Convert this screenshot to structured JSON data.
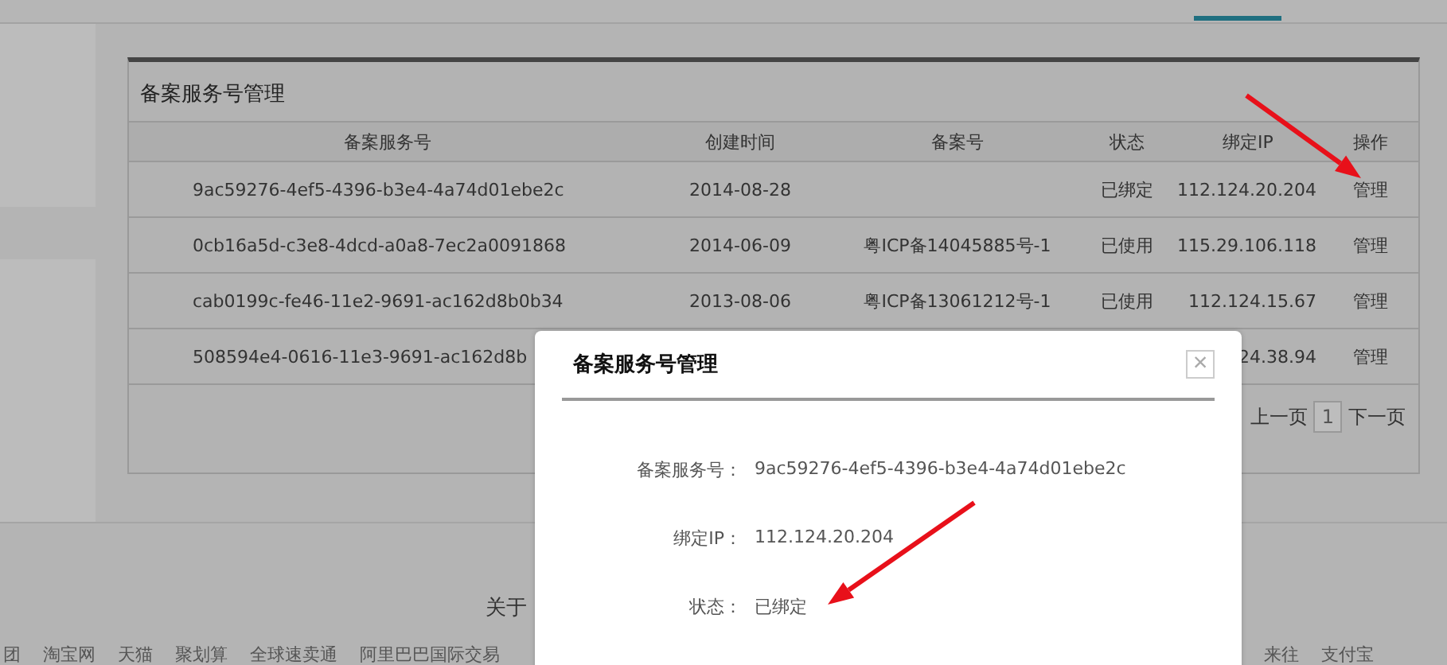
{
  "panel": {
    "title": "备案服务号管理",
    "columns": [
      "备案服务号",
      "创建时间",
      "备案号",
      "状态",
      "绑定IP",
      "操作"
    ],
    "rows": [
      {
        "service": "9ac59276-4ef5-4396-b3e4-4a74d01ebe2c",
        "created": "2014-08-28",
        "status": "已绑定",
        "ip": "112.124.20.204",
        "action": "管理"
      },
      {
        "service": "0cb16a5d-c3e8-4dcd-a0a8-7ec2a0091868",
        "created": "2014-06-09",
        "icp": "粤ICP备14045885号-1",
        "status": "已使用",
        "ip": "115.29.106.118",
        "action": "管理"
      },
      {
        "service": "cab0199c-fe46-11e2-9691-ac162d8b0b34",
        "created": "2013-08-06",
        "icp": "粤ICP备13061212号-1",
        "status": "已使用",
        "ip": "112.124.15.67",
        "action": "管理"
      },
      {
        "service": "508594e4-0616-11e3-9691-ac162d8b",
        "ip": "24.38.94",
        "action": "管理"
      }
    ],
    "pagination": {
      "prev": "上一页",
      "pages": [
        {
          "label": "1",
          "selected": true
        }
      ],
      "next": "下一页"
    }
  },
  "footer": {
    "about": "关于",
    "links": [
      "团",
      "淘宝网",
      "天猫",
      "聚划算",
      "全球速卖通",
      "阿里巴巴国际交易"
    ],
    "right_links": [
      "来往",
      "支付宝"
    ]
  },
  "dialog": {
    "title": "备案服务号管理",
    "close": "×",
    "fields": [
      {
        "label": "备案服务号：",
        "value": "9ac59276-4ef5-4396-b3e4-4a74d01ebe2c"
      },
      {
        "label": "绑定IP：",
        "value": "112.124.20.204"
      },
      {
        "label": "状态：",
        "value": "已绑定"
      }
    ]
  }
}
